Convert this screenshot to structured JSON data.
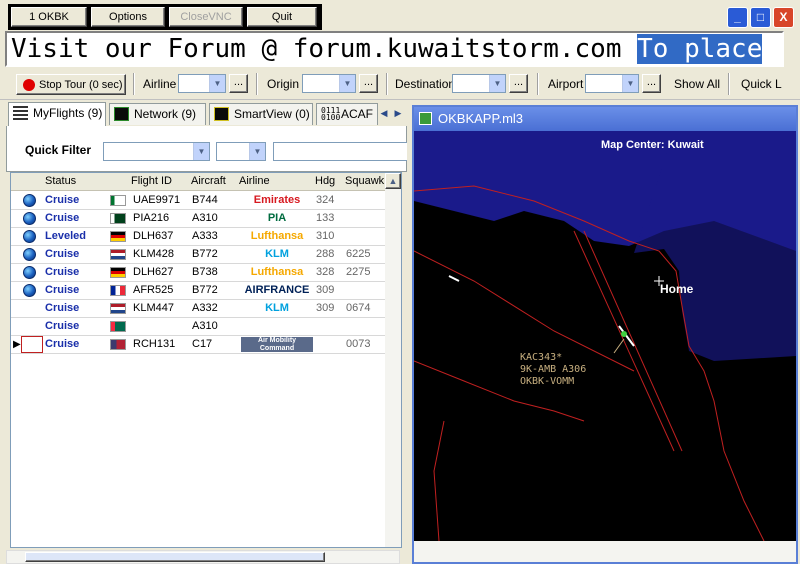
{
  "window": {
    "buttons": {
      "okbk": "1 OKBK",
      "options": "Options",
      "closevnc": "CloseVNC",
      "quit": "Quit"
    },
    "controls": {
      "minimize": "_",
      "maximize": "□",
      "close": "X"
    }
  },
  "ticker": {
    "text": "Visit our Forum @ forum.kuwaitstorm.com ",
    "selected_text": "To place"
  },
  "toolbar": {
    "stop_tour": "Stop Tour (0 sec)",
    "airline_label": "Airline",
    "origin_label": "Origin",
    "destination_label": "Destination",
    "airport_label": "Airport",
    "show_all": "Show All",
    "quick_label": "Quick L",
    "ellipsis": "..."
  },
  "tabs": [
    {
      "label": "MyFlights (9)",
      "icon": "list-icon"
    },
    {
      "label": "Network (9)",
      "icon": "network-icon"
    },
    {
      "label": "SmartView (0)",
      "icon": "smartview-icon"
    },
    {
      "label": "ACAF",
      "icon": "acars-icon"
    }
  ],
  "quick_filter": {
    "label": "Quick Filter"
  },
  "table": {
    "columns": [
      "Status",
      "Flight ID",
      "Aircraft",
      "Airline",
      "Hdg",
      "Squawk"
    ],
    "rows": [
      {
        "status": "Cruise",
        "flight": "UAE9971",
        "aircraft": "B744",
        "airline": "Emirates",
        "hdg": "324",
        "squawk": "",
        "globe": true
      },
      {
        "status": "Cruise",
        "flight": "PIA216",
        "aircraft": "A310",
        "airline": "PIA",
        "hdg": "133",
        "squawk": "",
        "globe": true
      },
      {
        "status": "Leveled",
        "flight": "DLH637",
        "aircraft": "A333",
        "airline": "Lufthansa",
        "hdg": "310",
        "squawk": "",
        "globe": true
      },
      {
        "status": "Cruise",
        "flight": "KLM428",
        "aircraft": "B772",
        "airline": "KLM",
        "hdg": "288",
        "squawk": "6225",
        "globe": true
      },
      {
        "status": "Cruise",
        "flight": "DLH627",
        "aircraft": "B738",
        "airline": "Lufthansa",
        "hdg": "328",
        "squawk": "2275",
        "globe": true
      },
      {
        "status": "Cruise",
        "flight": "AFR525",
        "aircraft": "B772",
        "airline": "AIRFRANCE",
        "hdg": "309",
        "squawk": "",
        "globe": true
      },
      {
        "status": "Cruise",
        "flight": "KLM447",
        "aircraft": "A332",
        "airline": "KLM",
        "hdg": "309",
        "squawk": "0674",
        "globe": false
      },
      {
        "status": "Cruise",
        "flight": "",
        "aircraft": "A310",
        "airline": "",
        "hdg": "",
        "squawk": "",
        "globe": false
      },
      {
        "status": "Cruise",
        "flight": "RCH131",
        "aircraft": "C17",
        "airline": "Air Mobility Command",
        "hdg": "",
        "squawk": "0073",
        "globe": false
      }
    ]
  },
  "map": {
    "title": "OKBKAPP.ml3",
    "center": "Map Center: Kuwait",
    "home": "Home",
    "target": {
      "line1": "KAC343*",
      "line2": "9K-AMB A306",
      "line3": "OKBK-VOMM"
    },
    "colors": {
      "land": "#1a1a8a",
      "line": "#c02020",
      "label": "#c8b080"
    }
  }
}
